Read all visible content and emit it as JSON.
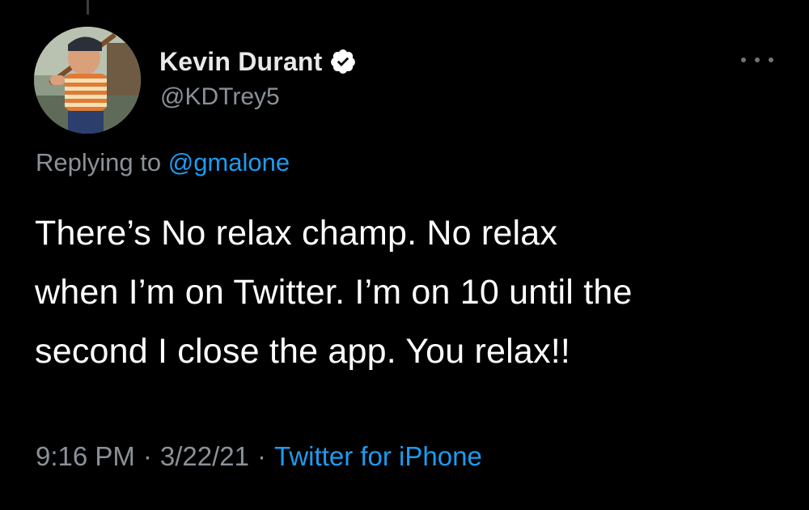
{
  "author": {
    "display_name": "Kevin Durant",
    "handle": "@KDTrey5",
    "verified_icon": "verified-badge-icon",
    "avatar_icon": "profile-avatar"
  },
  "reply": {
    "prefix": "Replying to",
    "mention": "@gmalone"
  },
  "tweet": {
    "lines": [
      "There’s No relax champ. No relax",
      "when I’m on Twitter. I’m on 10 until the",
      "second I close the app. You relax!!"
    ]
  },
  "meta": {
    "time": "9:16 PM",
    "separator": "·",
    "date": "3/22/21",
    "source": "Twitter for iPhone"
  },
  "colors": {
    "background": "#000000",
    "text": "#ffffff",
    "secondary": "#8b9198",
    "link": "#1d9bf0"
  }
}
